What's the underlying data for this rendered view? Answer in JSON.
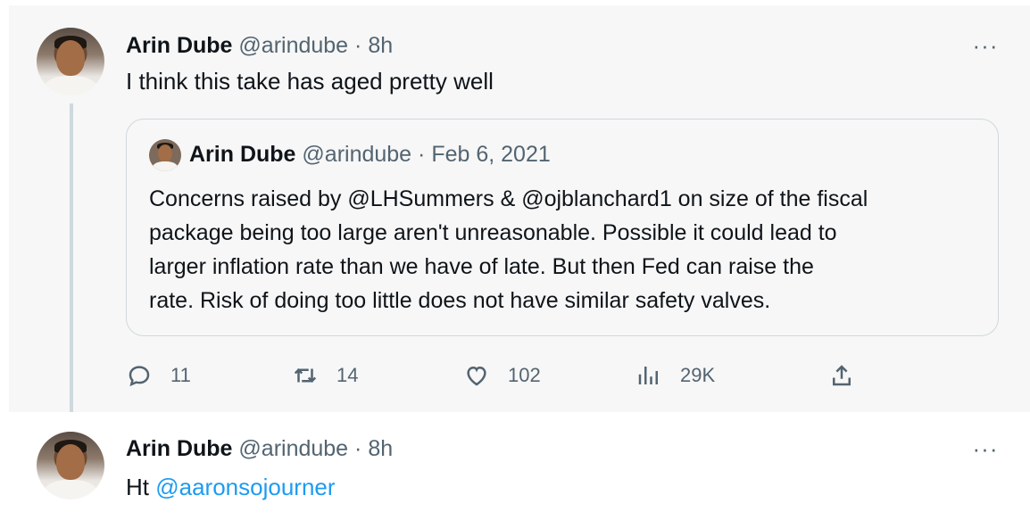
{
  "tweets": [
    {
      "name": "Arin Dube",
      "handle": "@arindube",
      "separator": "·",
      "time": "8h",
      "more": "···",
      "text": "I think this take has aged pretty well",
      "quote": {
        "name": "Arin Dube",
        "handle": "@arindube",
        "separator": "·",
        "date": "Feb 6, 2021",
        "lines": [
          "Concerns raised by @LHSummers & @ojblanchard1 on size of the fiscal",
          "package being too large aren't unreasonable. Possible it could lead to",
          "larger inflation rate than we have of late. But then Fed can raise the",
          "rate. Risk of doing too little does not have similar safety valves."
        ]
      },
      "actions": {
        "replies": "11",
        "retweets": "14",
        "likes": "102",
        "views": "29K"
      }
    },
    {
      "name": "Arin Dube",
      "handle": "@arindube",
      "separator": "·",
      "time": "8h",
      "more": "···",
      "text_prefix": "Ht",
      "mention": "@aaronsojourner"
    }
  ],
  "colors": {
    "accent": "#1d9bf0",
    "muted": "#536471",
    "highlight_bg": "#f7f7f7",
    "border": "#cfd9de"
  },
  "icons": [
    "reply-icon",
    "retweet-icon",
    "like-icon",
    "views-icon",
    "share-icon",
    "more-icon"
  ]
}
